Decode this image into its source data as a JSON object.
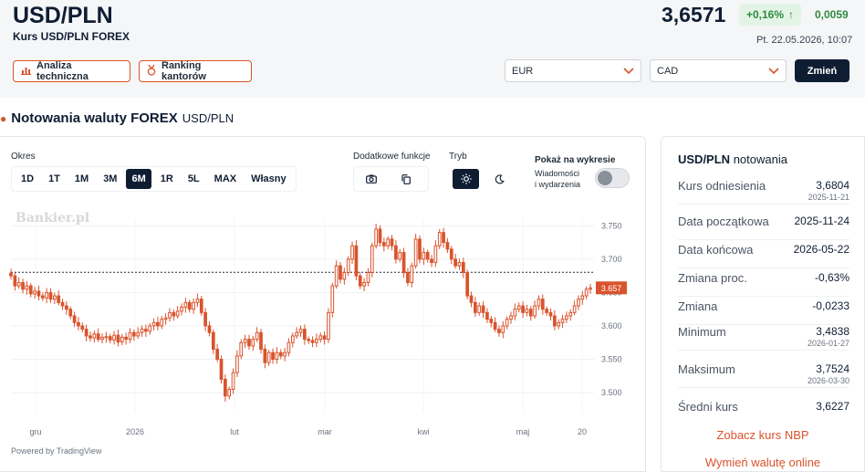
{
  "header": {
    "pair": "USD/PLN",
    "subtitle": "Kurs USD/PLN FOREX",
    "price": "3,6571",
    "change_pct": "+0,16%",
    "change_arrow": "↑",
    "change_abs": "0,0059",
    "timestamp": "Pt. 22.05.2026, 10:07",
    "tech_analysis_label": "Analiza techniczna",
    "ranking_label": "Ranking kantorów",
    "currency_from": "EUR",
    "currency_to": "CAD",
    "change_button": "Zmień"
  },
  "section": {
    "title": "Notowania waluty FOREX",
    "pair": "USD/PLN"
  },
  "controls": {
    "period_label": "Okres",
    "periods": [
      "1D",
      "1T",
      "1M",
      "3M",
      "6M",
      "1R",
      "5L",
      "MAX",
      "Własny"
    ],
    "active_period": "6M",
    "extra_label": "Dodatkowe funkcje",
    "mode_label": "Tryb",
    "show_label": "Pokaż na wykresie",
    "news_label_1": "Wiadomości",
    "news_label_2": "i wydarzenia"
  },
  "chart": {
    "watermark": "Bankier.pl",
    "powered_by": "Powered by TradingView",
    "x_ticks": [
      "gru",
      "2026",
      "lut",
      "mar",
      "kwi",
      "maj",
      "20"
    ],
    "y_ticks": [
      "3.750",
      "3.700",
      "3.650",
      "3.600",
      "3.550",
      "3.500"
    ],
    "last_price_tag": "3.657"
  },
  "chart_data": {
    "type": "candlestick",
    "y_range": [
      3.47,
      3.76
    ],
    "y_ticks": [
      3.75,
      3.7,
      3.65,
      3.6,
      3.55,
      3.5
    ],
    "x_ticks": [
      "gru",
      "2026",
      "lut",
      "mar",
      "kwi",
      "maj",
      "20"
    ],
    "reference_line": 3.6804,
    "last_price": 3.657,
    "closes": [
      3.675,
      3.66,
      3.665,
      3.655,
      3.66,
      3.648,
      3.652,
      3.645,
      3.642,
      3.65,
      3.64,
      3.645,
      3.635,
      3.63,
      3.625,
      3.615,
      3.605,
      3.6,
      3.595,
      3.585,
      3.582,
      3.588,
      3.58,
      3.583,
      3.584,
      3.579,
      3.586,
      3.576,
      3.583,
      3.58,
      3.59,
      3.585,
      3.59,
      3.595,
      3.592,
      3.6,
      3.605,
      3.6,
      3.61,
      3.612,
      3.62,
      3.615,
      3.622,
      3.628,
      3.635,
      3.625,
      3.635,
      3.64,
      3.62,
      3.6,
      3.59,
      3.565,
      3.55,
      3.52,
      3.495,
      3.505,
      3.53,
      3.555,
      3.575,
      3.58,
      3.57,
      3.58,
      3.59,
      3.565,
      3.545,
      3.56,
      3.55,
      3.56,
      3.555,
      3.56,
      3.575,
      3.585,
      3.59,
      3.595,
      3.58,
      3.578,
      3.575,
      3.58,
      3.585,
      3.58,
      3.62,
      3.66,
      3.69,
      3.67,
      3.68,
      3.7,
      3.72,
      3.675,
      3.66,
      3.665,
      3.68,
      3.72,
      3.745,
      3.725,
      3.72,
      3.73,
      3.72,
      3.7,
      3.71,
      3.68,
      3.665,
      3.69,
      3.73,
      3.7,
      3.71,
      3.7,
      3.695,
      3.72,
      3.74,
      3.725,
      3.715,
      3.7,
      3.69,
      3.695,
      3.68,
      3.645,
      3.635,
      3.62,
      3.63,
      3.62,
      3.61,
      3.605,
      3.595,
      3.59,
      3.6,
      3.61,
      3.615,
      3.625,
      3.63,
      3.62,
      3.625,
      3.615,
      3.63,
      3.64,
      3.625,
      3.62,
      3.615,
      3.6,
      3.605,
      3.61,
      3.615,
      3.62,
      3.63,
      3.64,
      3.645,
      3.655,
      3.657
    ]
  },
  "side": {
    "title_pair": "USD/PLN",
    "title_suffix": "notowania",
    "rows": [
      {
        "label": "Kurs odniesienia",
        "value": "3,6804",
        "date": "2025-11-21"
      },
      {
        "label": "Data początkowa",
        "value": "2025-11-24",
        "date": ""
      },
      {
        "label": "Data końcowa",
        "value": "2026-05-22",
        "date": ""
      },
      {
        "label": "Zmiana proc.",
        "value": "-0,63%",
        "date": ""
      },
      {
        "label": "Zmiana",
        "value": "-0,0233",
        "date": ""
      },
      {
        "label": "Minimum",
        "value": "3,4838",
        "date": "2026-01-27"
      },
      {
        "label": "Maksimum",
        "value": "3,7524",
        "date": "2026-03-30"
      },
      {
        "label": "Średni kurs",
        "value": "3,6227",
        "date": ""
      }
    ],
    "link_nbp": "Zobacz kurs NBP",
    "link_exchange": "Wymień walutę online"
  },
  "colors": {
    "accent": "#d9532c",
    "navy": "#0f1d33",
    "positive": "#2e8a3e"
  }
}
